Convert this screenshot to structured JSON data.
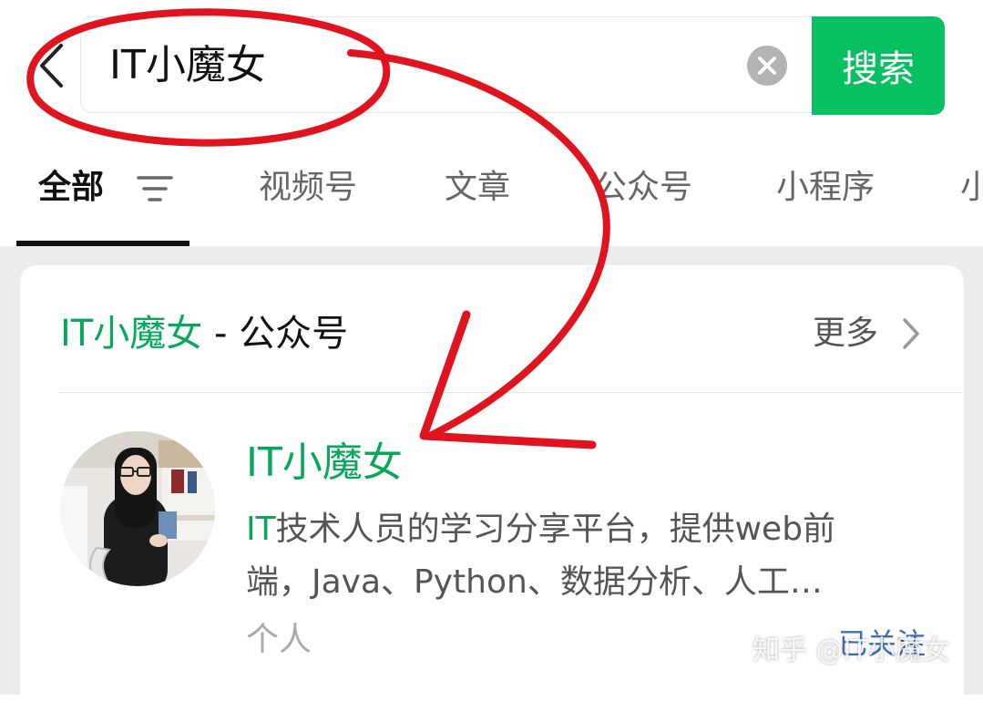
{
  "search": {
    "query": "IT小魔女",
    "button_label": "搜索"
  },
  "tabs": [
    {
      "label": "全部",
      "active": true
    },
    {
      "label": "视频号"
    },
    {
      "label": "文章"
    },
    {
      "label": "公众号"
    },
    {
      "label": "小程序"
    },
    {
      "label": "小"
    }
  ],
  "result_section": {
    "title_highlight": "IT小魔女",
    "title_suffix": " - 公众号",
    "more_label": "更多"
  },
  "account": {
    "name": "IT小魔女",
    "desc_highlight": "IT",
    "desc_line1_rest": "技术人员的学习分享平台，提供web前",
    "desc_line2": "端，Java、Python、数据分析、人工…",
    "type": "个人",
    "follow_status": "已关注"
  },
  "watermark": "知乎 @IT小魔女",
  "colors": {
    "accent_green": "#07c160",
    "highlight_green": "#07a85a",
    "annotation_red": "#e0141e"
  }
}
